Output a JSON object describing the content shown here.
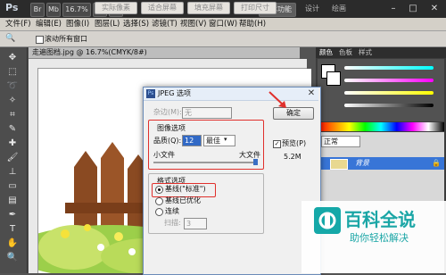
{
  "titlebar": {
    "logo": "Ps",
    "zoom": "16.7%",
    "workspace_active": "基本功能",
    "workspace_other": "设计",
    "workspace_more": "绘画",
    "window_controls": [
      "–",
      "□",
      "✕"
    ]
  },
  "menubar": {
    "items": [
      "文件(F)",
      "编辑(E)",
      "图像(I)",
      "图层(L)",
      "选择(S)",
      "滤镜(T)",
      "视图(V)",
      "窗口(W)",
      "帮助(H)"
    ]
  },
  "optionsbar": {
    "checkbox_label": "滚动所有窗口",
    "buttons": [
      "实际像素",
      "适合屏幕",
      "填充屏幕",
      "打印尺寸"
    ]
  },
  "document": {
    "tab_title": "走遍图档.jpg @ 16.7%(CMYK/8#)"
  },
  "panels": {
    "tabs": [
      "颜色",
      "色板",
      "样式"
    ],
    "layer_mode": "正常",
    "layer_name": "背景"
  },
  "dialog": {
    "title": "JPEG 选项",
    "close": "✕",
    "matte_label": "杂边(M):",
    "matte_value": "无",
    "image_options_legend": "图像选项",
    "quality_label": "品质(Q):",
    "quality_value": "12",
    "quality_level": "最佳",
    "small_file": "小文件",
    "large_file": "大文件",
    "format_legend": "格式选项",
    "format_options": [
      "基线(\"标准\")",
      "基线已优化",
      "连续"
    ],
    "scans_label": "扫描:",
    "scans_value": "3",
    "ok_button": "确定",
    "preview_label": "预览(P)",
    "file_size": "5.2M"
  },
  "watermark": {
    "title": "百科全说",
    "subtitle": "助你轻松解决"
  },
  "colors": {
    "highlight_red": "#e0302c",
    "watermark_teal": "#1ba6a6",
    "layer_selected": "#3875d7"
  }
}
